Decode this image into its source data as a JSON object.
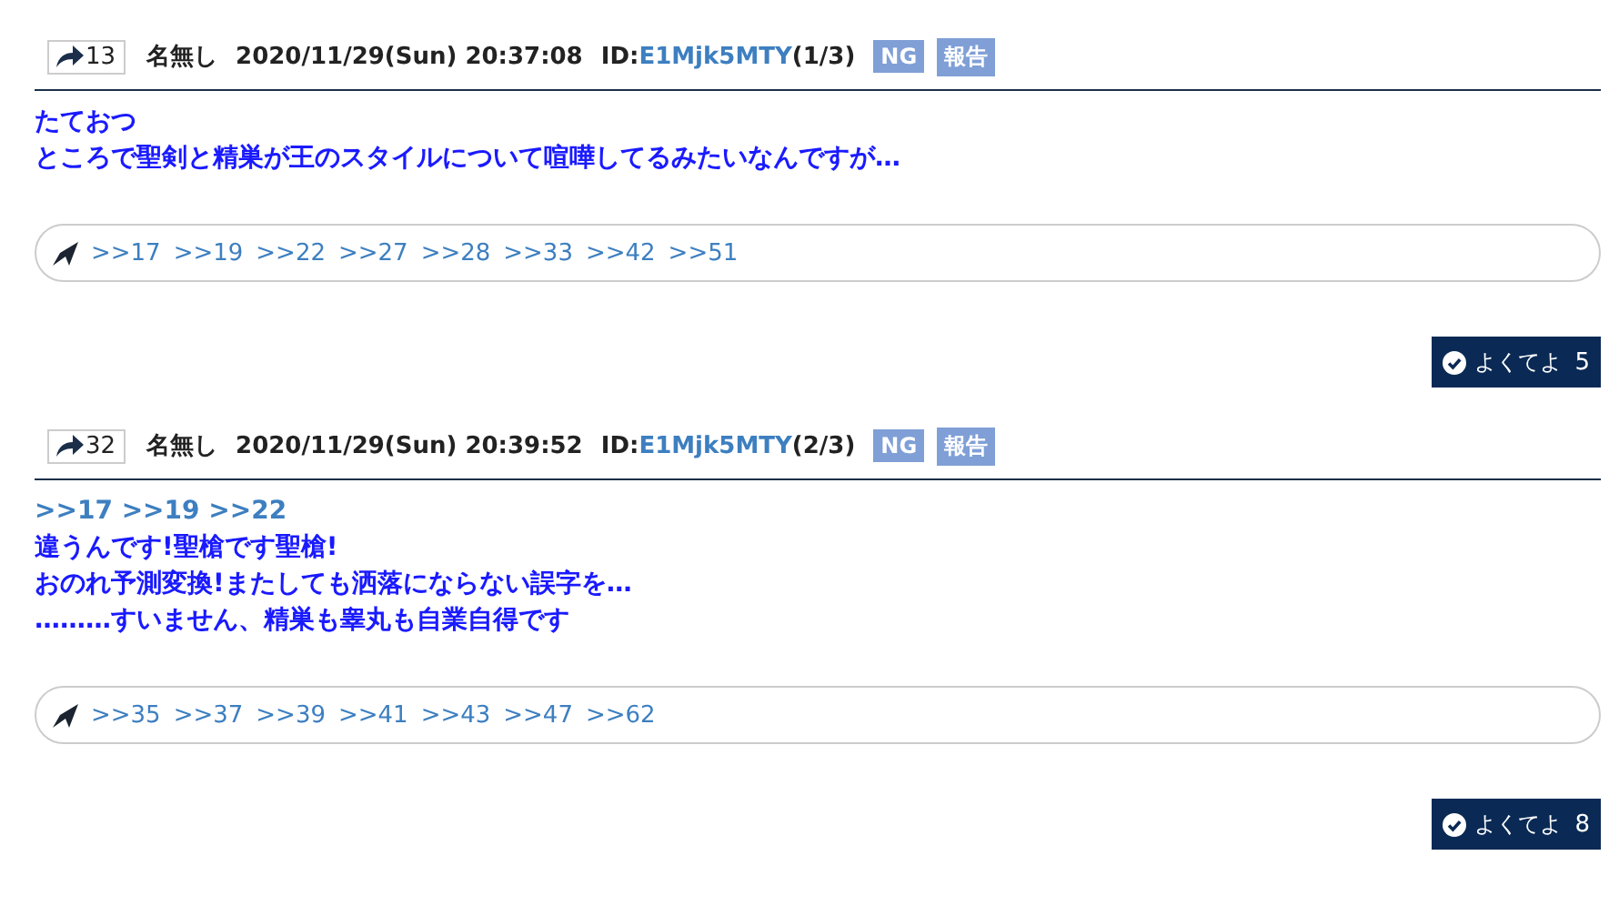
{
  "posts": [
    {
      "number": "13",
      "name": "名無し",
      "datetime": "2020/11/29(Sun) 20:37:08",
      "id_prefix": "ID:",
      "id": "E1Mjk5MTY",
      "id_count": "(1/3)",
      "ng": "NG",
      "report": "報告",
      "body": [
        {
          "kind": "text",
          "text": "たておつ"
        },
        {
          "kind": "text",
          "text": "ところで聖剣と精巣が王のスタイルについて喧嘩してるみたいなんですが…"
        }
      ],
      "replies": [
        ">>17",
        ">>19",
        ">>22",
        ">>27",
        ">>28",
        ">>33",
        ">>42",
        ">>51"
      ],
      "like_label": "よくてよ",
      "like_count": "5"
    },
    {
      "number": "32",
      "name": "名無し",
      "datetime": "2020/11/29(Sun) 20:39:52",
      "id_prefix": "ID:",
      "id": "E1Mjk5MTY",
      "id_count": "(2/3)",
      "ng": "NG",
      "report": "報告",
      "body": [
        {
          "kind": "anchor",
          "text": ">>17 >>19 >>22"
        },
        {
          "kind": "text",
          "text": "違うんです!聖槍です聖槍!"
        },
        {
          "kind": "text",
          "text": "おのれ予測変換!またしても洒落にならない誤字を…"
        },
        {
          "kind": "text",
          "text": "………すいません、精巣も睾丸も自業自得です"
        }
      ],
      "replies": [
        ">>35",
        ">>37",
        ">>39",
        ">>41",
        ">>43",
        ">>47",
        ">>62"
      ],
      "like_label": "よくてよ",
      "like_count": "8"
    }
  ]
}
